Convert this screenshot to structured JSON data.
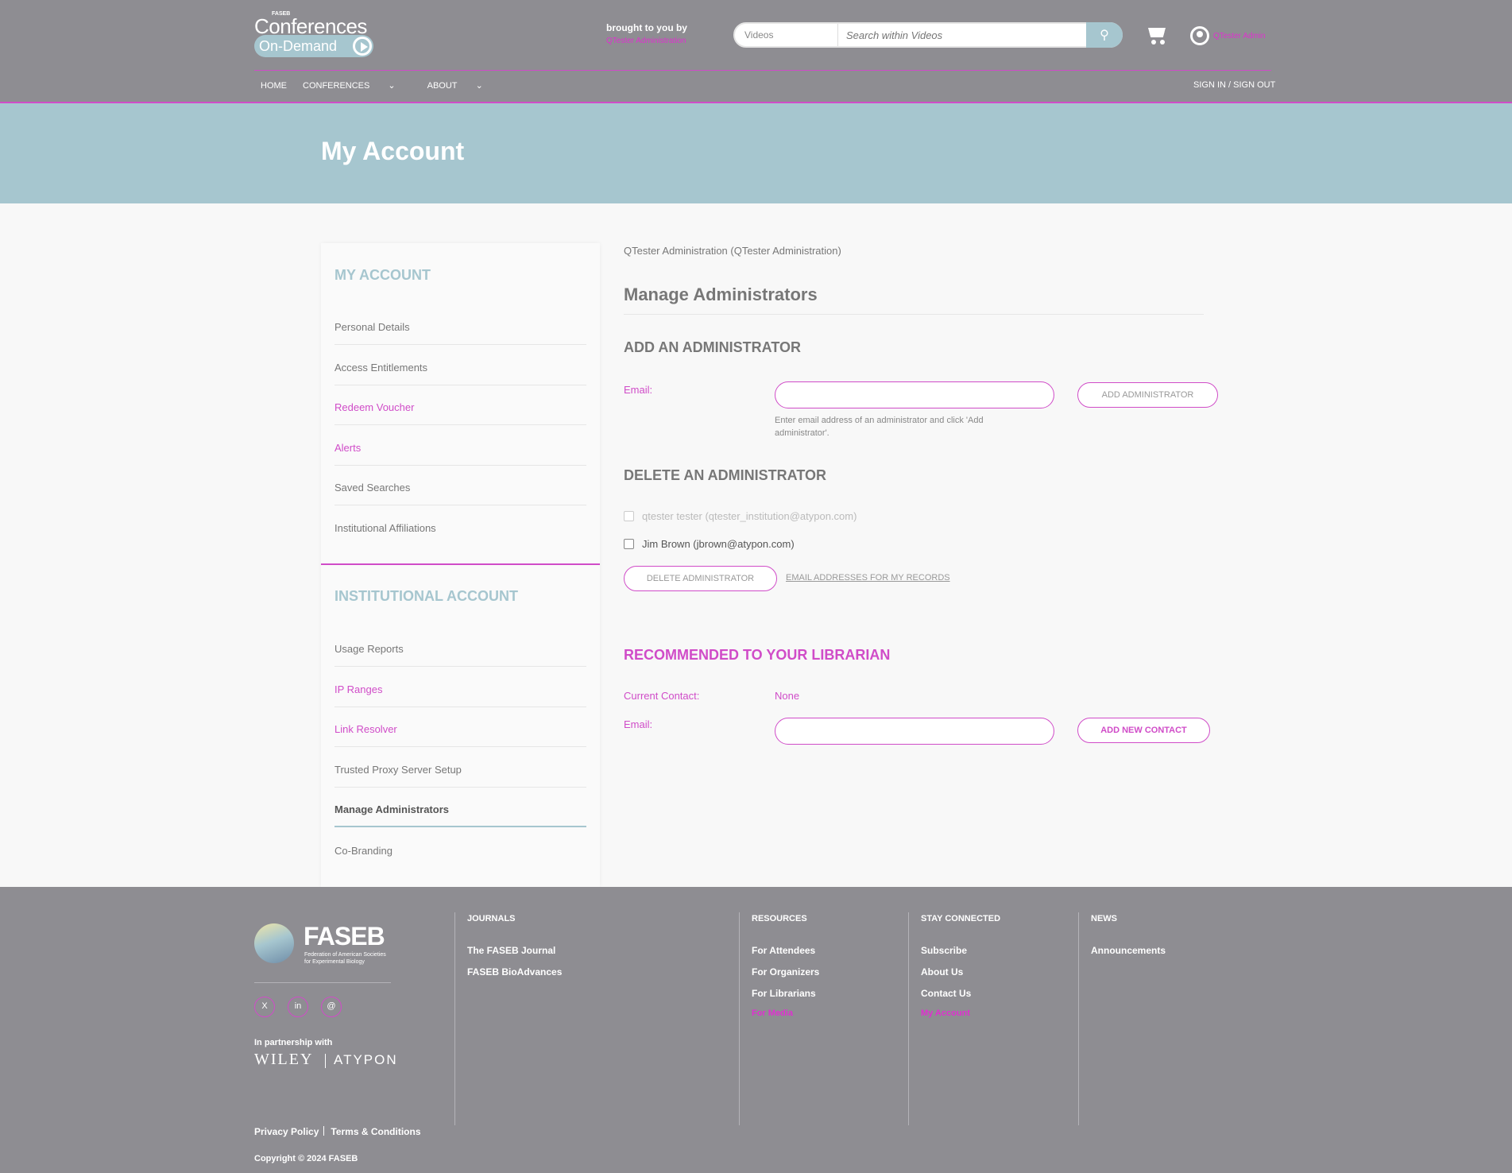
{
  "header": {
    "logo_small": "FASEB",
    "logo_main": "Conferences",
    "logo_sub": "On-Demand",
    "brought_by": "brought to you by",
    "brought_by_name": "QTester Administration",
    "search_scope": "Videos",
    "search_placeholder": "Search within Videos",
    "user_label": "QTester Admin",
    "nav": [
      "HOME",
      "CONFERENCES",
      "ABOUT"
    ],
    "signout": "SIGN IN / SIGN OUT"
  },
  "banner": {
    "title": "My Account"
  },
  "sidebar": {
    "my_account_heading": "MY ACCOUNT",
    "my_account_items": [
      {
        "label": "Personal Details"
      },
      {
        "label": "Access Entitlements"
      },
      {
        "label": "Redeem Voucher"
      },
      {
        "label": "Alerts"
      },
      {
        "label": "Saved Searches"
      },
      {
        "label": "Institutional Affiliations"
      }
    ],
    "institutional_heading": "INSTITUTIONAL ACCOUNT",
    "institutional_items": [
      {
        "label": "Usage Reports"
      },
      {
        "label": "IP Ranges"
      },
      {
        "label": "Link Resolver"
      },
      {
        "label": "Trusted Proxy Server Setup"
      },
      {
        "label": "Manage Administrators",
        "active": true
      },
      {
        "label": "Co-Branding"
      }
    ]
  },
  "main": {
    "institution": "QTester Administration (QTester Administration)",
    "title": "Manage Administrators",
    "add": {
      "heading": "ADD AN ADMINISTRATOR",
      "email_label": "Email:",
      "email_value": "",
      "button": "ADD ADMINISTRATOR",
      "help": "Enter email address of an administrator and click 'Add administrator'."
    },
    "delete": {
      "heading": "DELETE AN ADMINISTRATOR",
      "admins": [
        {
          "label": "qtester tester (qtester_institution@atypon.com)",
          "disabled": true,
          "checked": false
        },
        {
          "label": "Jim Brown (jbrown@atypon.com)",
          "disabled": false,
          "checked": false
        }
      ],
      "button": "DELETE ADMINISTRATOR",
      "email_link": "EMAIL ADDRESSES FOR MY RECORDS"
    },
    "recommend": {
      "heading": "RECOMMENDED TO YOUR LIBRARIAN",
      "contact_label": "Current Contact:",
      "contact_value": "None",
      "email_label": "Email:",
      "email_value": "",
      "button": "ADD NEW CONTACT"
    }
  },
  "footer": {
    "logo_name": "FASEB",
    "logo_sub": "Federation of American Societies for Experimental Biology",
    "social": [
      "X",
      "in",
      "@"
    ],
    "partnership": "In partnership with",
    "partner1": "WILEY",
    "partner2": "ATYPON",
    "columns": [
      {
        "heading": "JOURNALS",
        "links": [
          "The FASEB Journal",
          "FASEB BioAdvances"
        ]
      },
      {
        "heading": "RESOURCES",
        "links": [
          "For Attendees",
          "For Organizers",
          "For Librarians",
          "For Media"
        ]
      },
      {
        "heading": "STAY CONNECTED",
        "links": [
          "Subscribe",
          "About Us",
          "Contact Us",
          "My Account"
        ]
      },
      {
        "heading": "NEWS",
        "links": [
          "Announcements"
        ]
      }
    ],
    "privacy": "Privacy Policy",
    "terms": "Terms & Conditions",
    "copyright": "Copyright © 2024 FASEB"
  }
}
